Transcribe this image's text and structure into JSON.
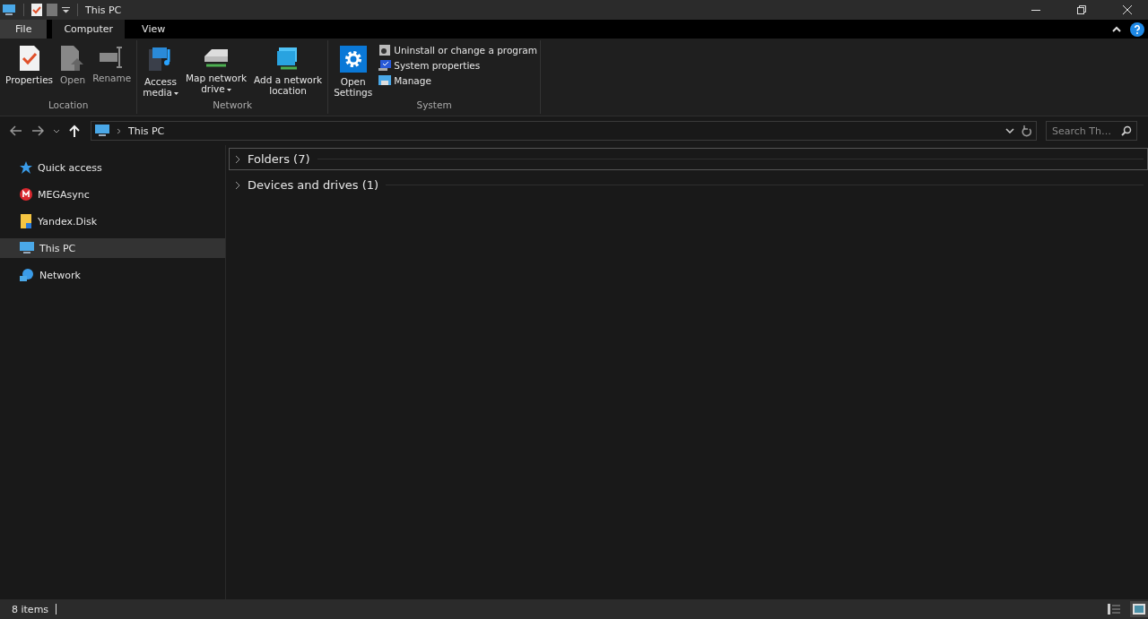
{
  "window": {
    "title": "This PC"
  },
  "tabs": [
    {
      "label": "File",
      "kind": "file",
      "selected": false
    },
    {
      "label": "Computer",
      "kind": "tab",
      "selected": true
    },
    {
      "label": "View",
      "kind": "tab",
      "selected": false
    }
  ],
  "ribbon_groups": [
    {
      "label": "Location",
      "buttons": [
        {
          "kind": "properties",
          "lines": [
            "Properties"
          ],
          "dropdown": false,
          "disabled": false
        },
        {
          "kind": "open",
          "lines": [
            "Open"
          ],
          "dropdown": false,
          "disabled": true
        },
        {
          "kind": "rename",
          "lines": [
            "Rename"
          ],
          "dropdown": false,
          "disabled": true
        }
      ]
    },
    {
      "label": "Network",
      "buttons": [
        {
          "kind": "media",
          "lines": [
            "Access",
            "media"
          ],
          "dropdown": true,
          "disabled": false
        },
        {
          "kind": "drive",
          "lines": [
            "Map network",
            "drive"
          ],
          "dropdown": true,
          "disabled": false
        },
        {
          "kind": "netloc",
          "lines": [
            "Add a network",
            "location"
          ],
          "dropdown": false,
          "disabled": false
        }
      ]
    },
    {
      "label": "System",
      "buttons": [
        {
          "kind": "settings",
          "lines": [
            "Open",
            "Settings"
          ],
          "dropdown": false,
          "disabled": false
        }
      ],
      "small_buttons": [
        {
          "kind": "uninstall",
          "label": "Uninstall or change a program"
        },
        {
          "kind": "sysprops",
          "label": "System properties"
        },
        {
          "kind": "manage",
          "label": "Manage"
        }
      ]
    }
  ],
  "address_bar": {
    "path": "This PC"
  },
  "search": {
    "placeholder": "Search Th…"
  },
  "sidebar": {
    "items": [
      {
        "label": "Quick access",
        "kind": "star",
        "selected": false
      },
      {
        "label": "MEGAsync",
        "kind": "mega",
        "selected": false
      },
      {
        "label": "Yandex.Disk",
        "kind": "yandex",
        "selected": false
      },
      {
        "label": "This PC",
        "kind": "pc",
        "selected": true
      },
      {
        "label": "Network",
        "kind": "network",
        "selected": false
      }
    ]
  },
  "groups": [
    {
      "label": "Folders (7)",
      "focused": true
    },
    {
      "label": "Devices and drives (1)",
      "focused": false
    }
  ],
  "status_bar": {
    "text": "8 items",
    "view_buttons": [
      {
        "kind": "details",
        "selected": false
      },
      {
        "kind": "large-icons",
        "selected": true
      }
    ]
  }
}
